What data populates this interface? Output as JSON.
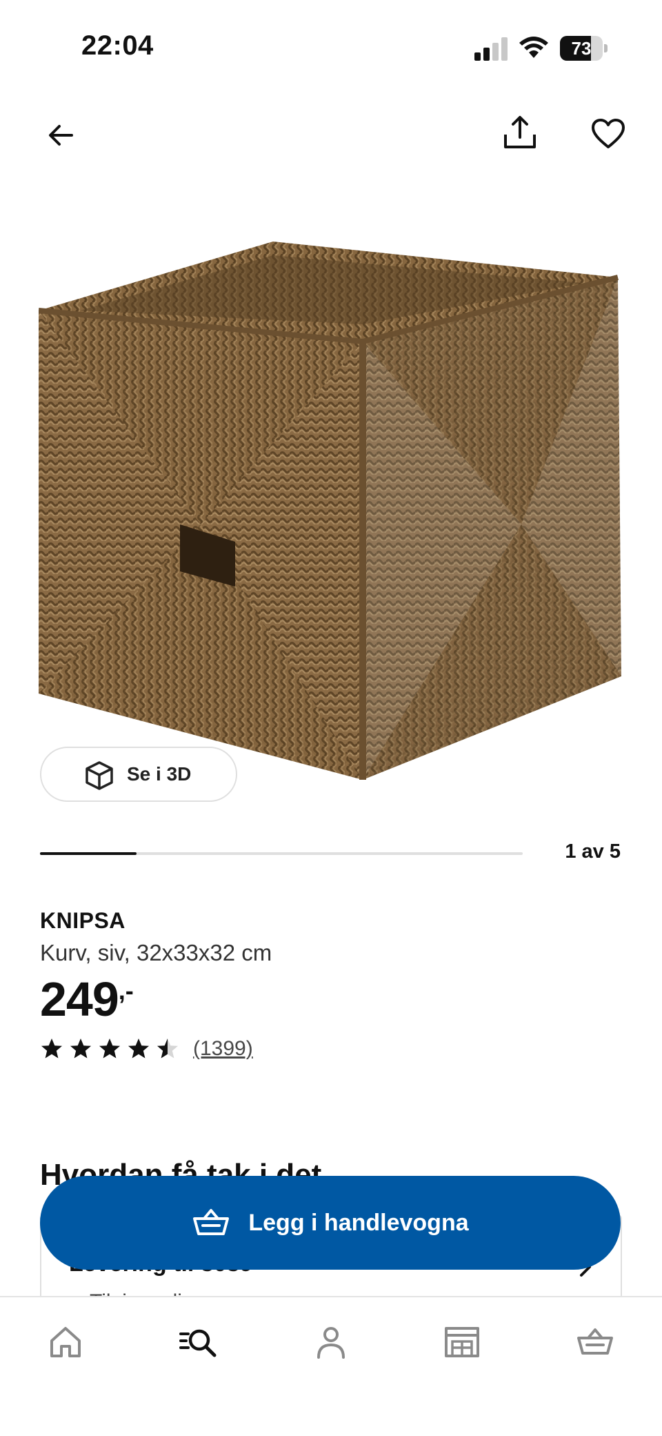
{
  "status_bar": {
    "time": "22:04",
    "battery_percent": 73,
    "battery_label": "73"
  },
  "nav": {
    "back_icon": "arrow-left-icon",
    "share_icon": "share-icon",
    "favourite_icon": "heart-icon"
  },
  "gallery": {
    "view_3d_label": "Se i 3D",
    "current_image": 1,
    "total_images": 5,
    "counter_text": "1 av 5"
  },
  "product": {
    "name": "KNIPSA",
    "description": "Kurv, siv, 32x33x32 cm",
    "price": "249",
    "price_suffix": ",-",
    "rating": 4.5,
    "rating_max": 5,
    "review_count_text": "(1399)"
  },
  "availability": {
    "section_title": "Hvordan få tak i det",
    "delivery_title": "Levering til 3039",
    "delivery_status": "Tilgjengelig"
  },
  "cart": {
    "button_label": "Legg i handlevogna",
    "button_color": "#0058a3"
  },
  "tab_bar": {
    "items": [
      {
        "icon": "home-icon"
      },
      {
        "icon": "search-list-icon",
        "active": true
      },
      {
        "icon": "profile-icon"
      },
      {
        "icon": "store-icon"
      },
      {
        "icon": "cart-icon"
      }
    ]
  }
}
